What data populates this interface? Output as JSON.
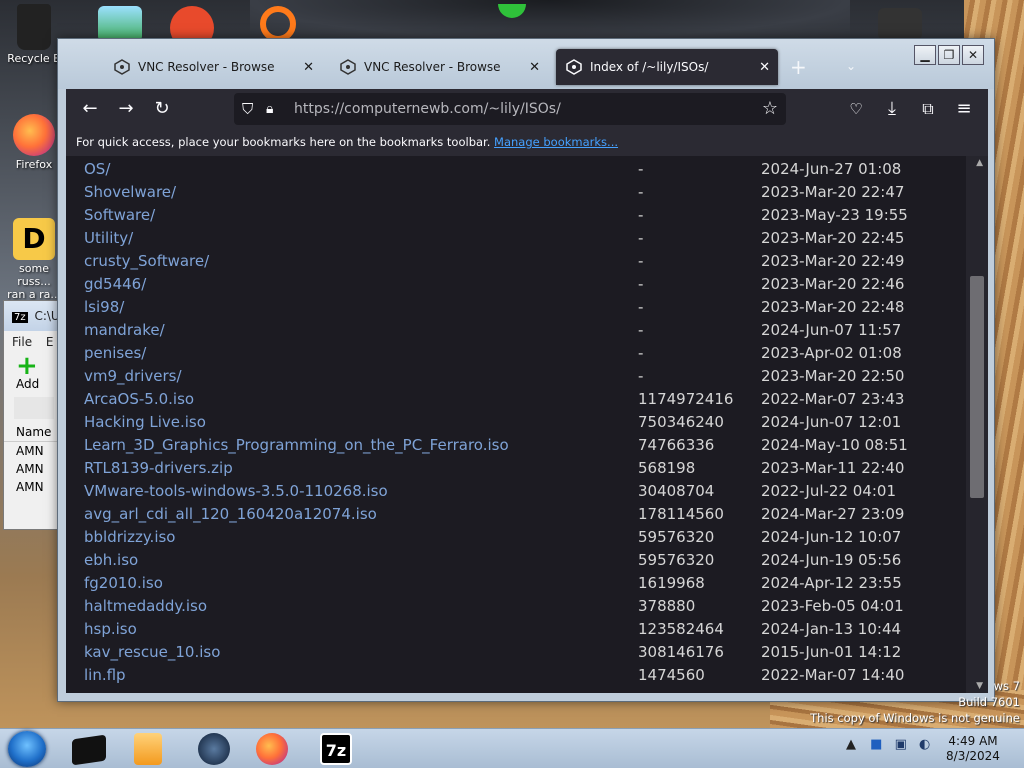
{
  "desktop": {
    "icons": [
      {
        "label": "Recycle B"
      },
      {
        "label": "Firefox"
      },
      {
        "label": "some russ..."
      },
      {
        "label": "ran a ra..."
      }
    ],
    "watermark_lines": [
      "ws 7",
      "Build 7601",
      "This copy of Windows is not genuine"
    ]
  },
  "sevenzip": {
    "title": "C:\\U",
    "menu": [
      "File",
      "E"
    ],
    "add_label": "Add",
    "column_header": "Name",
    "rows": [
      "AMN",
      "AMN",
      "AMN"
    ]
  },
  "browser": {
    "tabs": [
      {
        "label": "VNC Resolver - Browse",
        "active": false
      },
      {
        "label": "VNC Resolver - Browse",
        "active": false
      },
      {
        "label": "Index of /~lily/ISOs/",
        "active": true
      }
    ],
    "new_tab": "+",
    "url": "https://computernewb.com/~lily/ISOs/",
    "bookmarks_message": "For quick access, place your bookmarks here on the bookmarks toolbar.",
    "bookmarks_link": "Manage bookmarks...",
    "listing": [
      {
        "name": "OS/",
        "size": "-",
        "date": "2024-Jun-27 01:08"
      },
      {
        "name": "Shovelware/",
        "size": "-",
        "date": "2023-Mar-20 22:47"
      },
      {
        "name": "Software/",
        "size": "-",
        "date": "2023-May-23 19:55"
      },
      {
        "name": "Utility/",
        "size": "-",
        "date": "2023-Mar-20 22:45"
      },
      {
        "name": "crusty_Software/",
        "size": "-",
        "date": "2023-Mar-20 22:49"
      },
      {
        "name": "gd5446/",
        "size": "-",
        "date": "2023-Mar-20 22:46"
      },
      {
        "name": "lsi98/",
        "size": "-",
        "date": "2023-Mar-20 22:48"
      },
      {
        "name": "mandrake/",
        "size": "-",
        "date": "2024-Jun-07 11:57"
      },
      {
        "name": "penises/",
        "size": "-",
        "date": "2023-Apr-02 01:08"
      },
      {
        "name": "vm9_drivers/",
        "size": "-",
        "date": "2023-Mar-20 22:50"
      },
      {
        "name": "ArcaOS-5.0.iso",
        "size": "1174972416",
        "date": "2022-Mar-07 23:43"
      },
      {
        "name": "Hacking Live.iso",
        "size": "750346240",
        "date": "2024-Jun-07 12:01"
      },
      {
        "name": "Learn_3D_Graphics_Programming_on_the_PC_Ferraro.iso",
        "size": "74766336",
        "date": "2024-May-10 08:51"
      },
      {
        "name": "RTL8139-drivers.zip",
        "size": "568198",
        "date": "2023-Mar-11 22:40"
      },
      {
        "name": "VMware-tools-windows-3.5.0-110268.iso",
        "size": "30408704",
        "date": "2022-Jul-22 04:01"
      },
      {
        "name": "avg_arl_cdi_all_120_160420a12074.iso",
        "size": "178114560",
        "date": "2024-Mar-27 23:09"
      },
      {
        "name": "bbldrizzy.iso",
        "size": "59576320",
        "date": "2024-Jun-12 10:07"
      },
      {
        "name": "ebh.iso",
        "size": "59576320",
        "date": "2024-Jun-19 05:56"
      },
      {
        "name": "fg2010.iso",
        "size": "1619968",
        "date": "2024-Apr-12 23:55"
      },
      {
        "name": "haltmedaddy.iso",
        "size": "378880",
        "date": "2023-Feb-05 04:01"
      },
      {
        "name": "hsp.iso",
        "size": "123582464",
        "date": "2024-Jan-13 10:44"
      },
      {
        "name": "kav_rescue_10.iso",
        "size": "308146176",
        "date": "2015-Jun-01 14:12"
      },
      {
        "name": "lin.flp",
        "size": "1474560",
        "date": "2022-Mar-07 14:40"
      }
    ]
  },
  "taskbar": {
    "clock_time": "4:49 AM",
    "clock_date": "8/3/2024",
    "sevenzip_label": "7z"
  }
}
